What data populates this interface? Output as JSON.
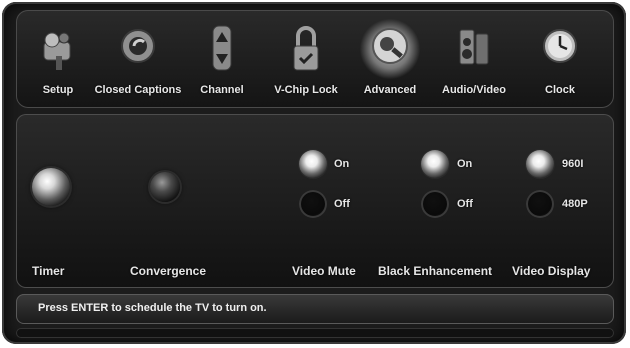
{
  "menu": {
    "items": [
      {
        "label": "Setup",
        "icon": "setup-icon"
      },
      {
        "label": "Closed Captions",
        "icon": "closed-captions-icon"
      },
      {
        "label": "Channel",
        "icon": "channel-arrows-icon"
      },
      {
        "label": "V-Chip Lock",
        "icon": "lock-icon"
      },
      {
        "label": "Advanced",
        "icon": "advanced-icon",
        "selected": true
      },
      {
        "label": "Audio/Video",
        "icon": "audio-video-icon"
      },
      {
        "label": "Clock",
        "icon": "clock-icon"
      }
    ]
  },
  "panel": {
    "timer_label": "Timer",
    "convergence_label": "Convergence",
    "video_mute": {
      "label": "Video Mute",
      "opt1": "On",
      "opt2": "Off",
      "selected": "On"
    },
    "black_enhancement": {
      "label": "Black Enhancement",
      "opt1": "On",
      "opt2": "Off",
      "selected": "On"
    },
    "video_display": {
      "label": "Video Display",
      "opt1": "960I",
      "opt2": "480P",
      "selected": "960I"
    }
  },
  "status": {
    "text": "Press ENTER to schedule the TV to turn on."
  }
}
